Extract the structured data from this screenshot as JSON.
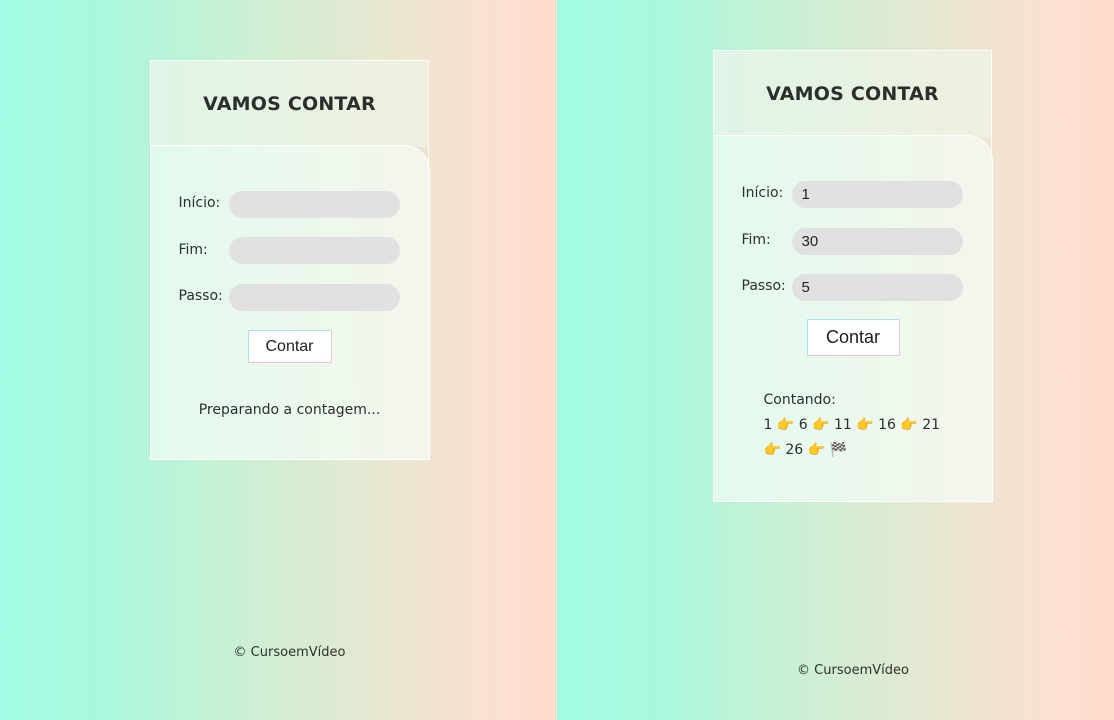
{
  "left": {
    "title": "VAMOS CONTAR",
    "fields": [
      {
        "label": "Início:",
        "value": ""
      },
      {
        "label": "Fim:",
        "value": ""
      },
      {
        "label": "Passo:",
        "value": ""
      }
    ],
    "button_label": "Contar",
    "result_text": "Preparando a contagem...",
    "footer": "© CursoemVídeo"
  },
  "right": {
    "title": "VAMOS CONTAR",
    "fields": [
      {
        "label": "Início:",
        "value": "1"
      },
      {
        "label": "Fim:",
        "value": "30"
      },
      {
        "label": "Passo:",
        "value": "5"
      }
    ],
    "button_label": "Contar",
    "result_heading": "Contando:",
    "result_line_1": "1 👉 6 👉 11 👉 16 👉 21",
    "result_line_2": "👉 26 👉 🏁",
    "footer": "© CursoemVídeo"
  }
}
